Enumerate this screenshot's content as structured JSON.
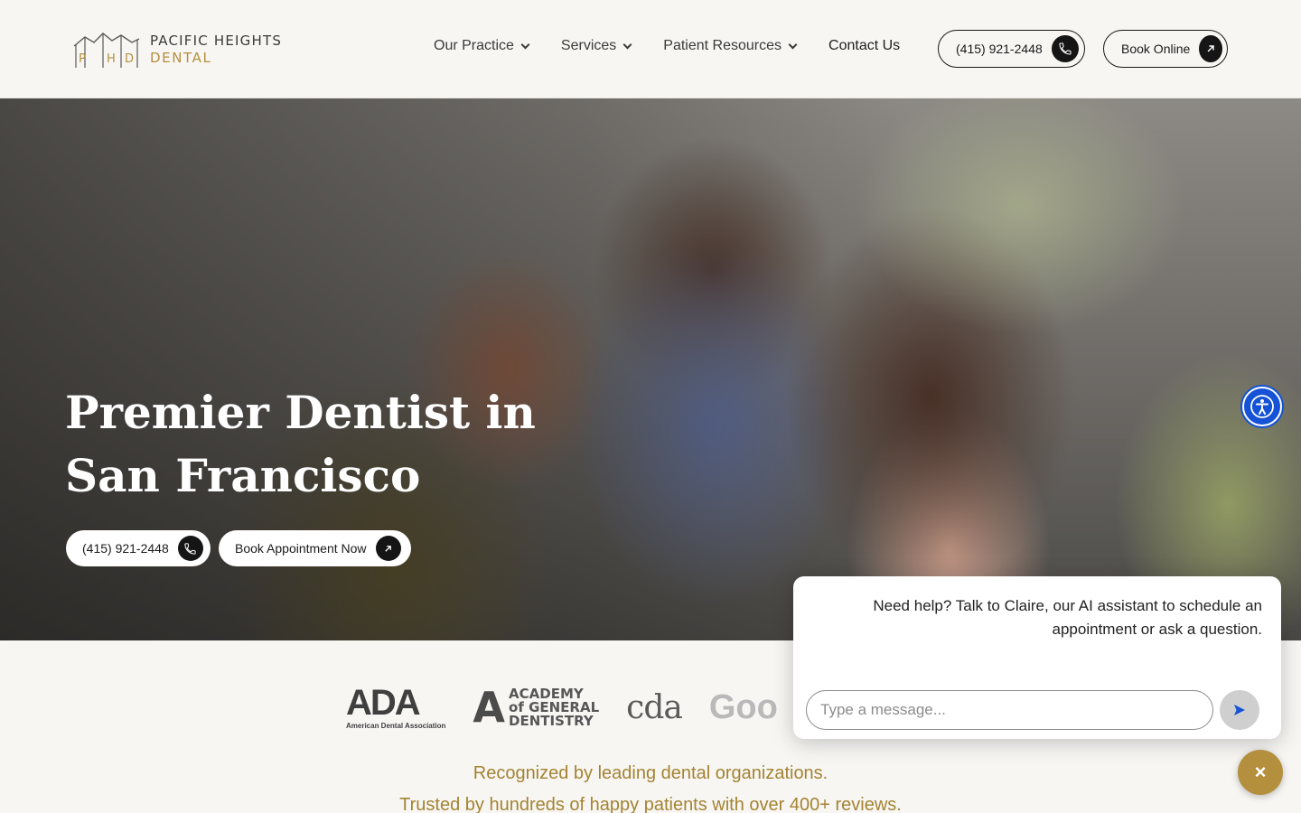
{
  "header": {
    "logo": {
      "line1": "PACIFIC HEIGHTS",
      "line2": "DENTAL",
      "monogram": "PHD",
      "brand_gold": "#b48f3e"
    },
    "nav": [
      {
        "label": "Our Practice",
        "has_dropdown": true
      },
      {
        "label": "Services",
        "has_dropdown": true
      },
      {
        "label": "Patient Resources",
        "has_dropdown": true
      },
      {
        "label": "Contact Us",
        "has_dropdown": false
      }
    ],
    "phone_button": {
      "label": "(415) 921-2448",
      "icon": "phone-icon"
    },
    "book_button": {
      "label": "Book Online",
      "icon": "arrow-up-right-icon"
    }
  },
  "hero": {
    "title": "Premier Dentist in San Francisco",
    "phone_button": {
      "label": "(415) 921-2448",
      "icon": "phone-icon"
    },
    "book_button": {
      "label": "Book Appointment Now",
      "icon": "arrow-up-right-icon"
    },
    "accessibility_button": {
      "icon": "accessibility-icon",
      "color": "#1552d6"
    }
  },
  "organizations": {
    "ada": {
      "mark": "ADA",
      "caption": "American Dental Association"
    },
    "agd": {
      "mark": "A",
      "lines": [
        "ACADEMY",
        "of GENERAL",
        "DENTISTRY"
      ]
    },
    "cda": {
      "mark": "cda"
    },
    "google": {
      "mark": "Goo"
    }
  },
  "taglines": {
    "line1": "Recognized by leading dental organizations.",
    "line2": "Trusted by hundreds of happy patients with over 400+ reviews."
  },
  "chat": {
    "message": "Need help? Talk to Claire, our AI assistant to schedule an appointment or ask a question.",
    "input_placeholder": "Type a message...",
    "send_icon": "send-icon",
    "close_label": "×",
    "close_color": "#b48f3e"
  }
}
